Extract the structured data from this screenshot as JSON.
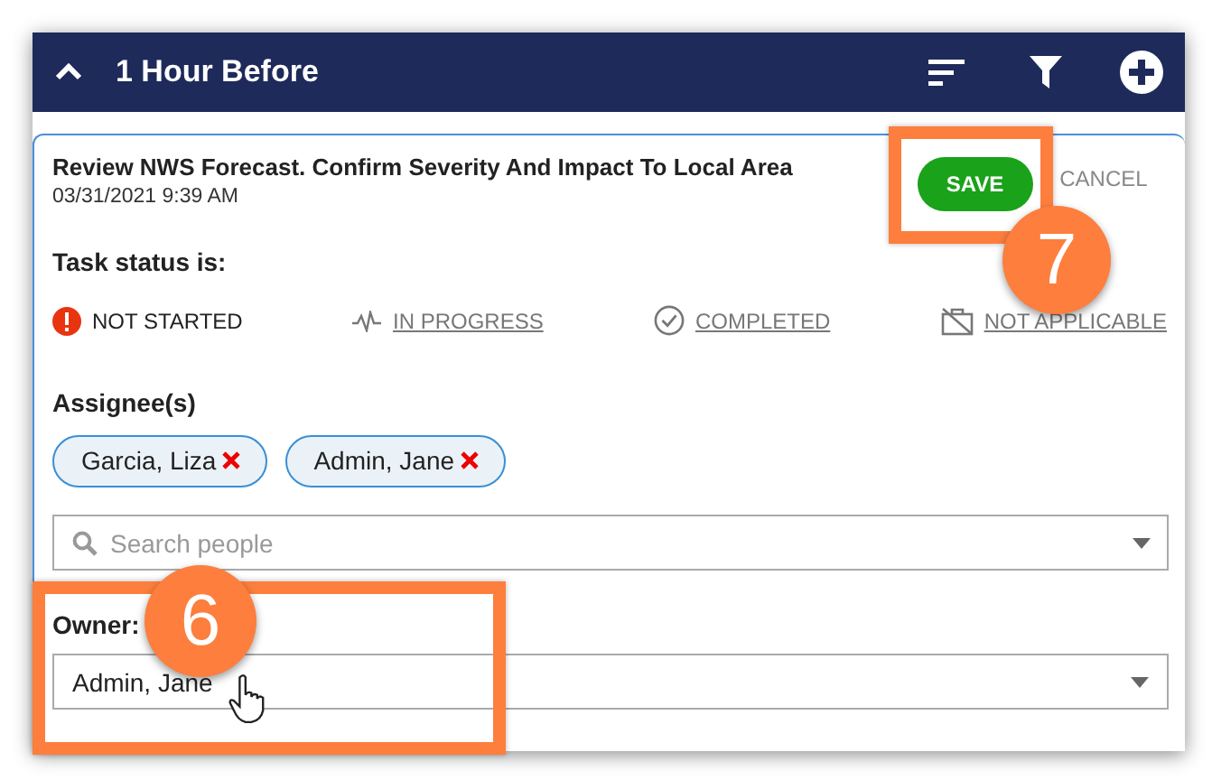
{
  "header": {
    "title": "1 Hour Before"
  },
  "task": {
    "title": "Review NWS Forecast. Confirm Severity And Impact To Local Area",
    "timestamp": "03/31/2021 9:39 AM",
    "save": "SAVE",
    "cancel": "CANCEL"
  },
  "status": {
    "label": "Task status is:",
    "options": [
      {
        "kind": "not_started",
        "label": "NOT STARTED",
        "selected": true
      },
      {
        "kind": "in_progress",
        "label": "IN PROGRESS",
        "selected": false
      },
      {
        "kind": "completed",
        "label": "COMPLETED",
        "selected": false
      },
      {
        "kind": "not_applicable",
        "label": "NOT APPLICABLE",
        "selected": false
      }
    ]
  },
  "assignees": {
    "label": "Assignee(s)",
    "chips": [
      "Garcia, Liza",
      "Admin, Jane"
    ],
    "search": {
      "placeholder": "Search people"
    }
  },
  "owner": {
    "label": "Owner:",
    "value": "Admin, Jane"
  },
  "callouts": [
    {
      "number": "7"
    },
    {
      "number": "6"
    }
  ]
}
